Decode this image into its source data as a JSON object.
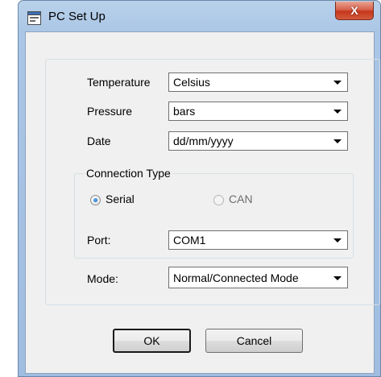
{
  "window": {
    "title": "PC Set Up",
    "close_glyph": "X",
    "icon": "app-window-icon"
  },
  "fields": {
    "temperature": {
      "label": "Temperature",
      "value": "Celsius"
    },
    "pressure": {
      "label": "Pressure",
      "value": "bars"
    },
    "date": {
      "label": "Date",
      "value": "dd/mm/yyyy"
    }
  },
  "connection": {
    "legend": "Connection Type",
    "options": [
      {
        "label": "Serial",
        "selected": true,
        "enabled": true
      },
      {
        "label": "CAN",
        "selected": false,
        "enabled": false
      }
    ],
    "port": {
      "label": "Port:",
      "value": "COM1"
    }
  },
  "mode": {
    "label": "Mode:",
    "value": "Normal/Connected Mode"
  },
  "buttons": {
    "ok": "OK",
    "cancel": "Cancel"
  },
  "colors": {
    "radio_selected": "#1f6fc4",
    "close_button": "#c4371c",
    "frame": "#aac6e6"
  }
}
